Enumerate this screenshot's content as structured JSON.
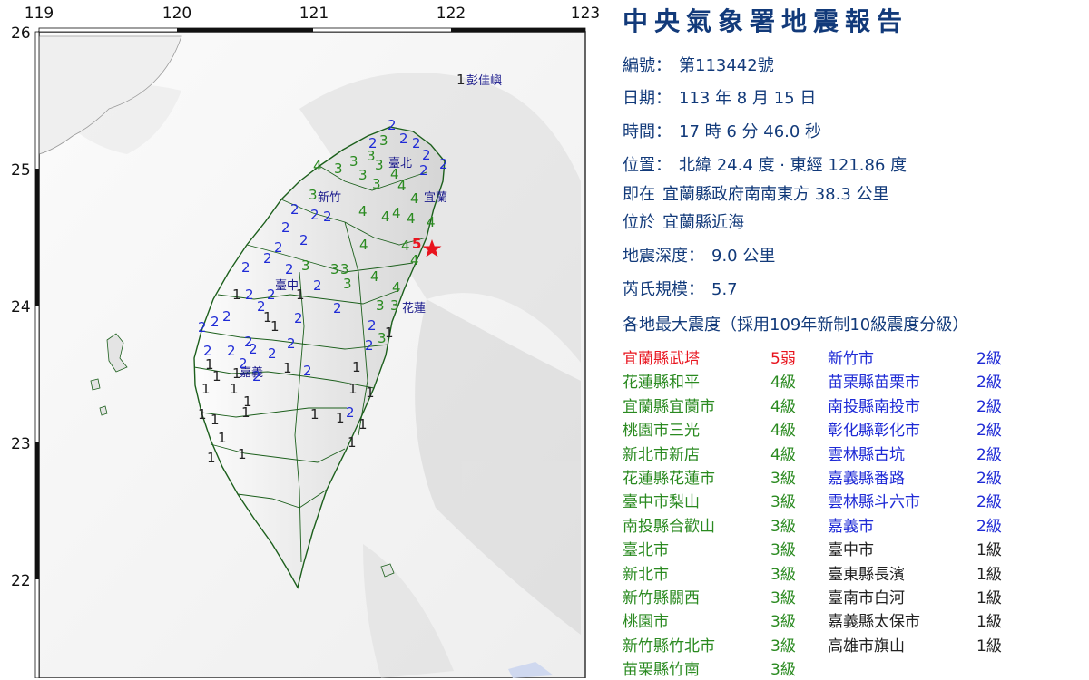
{
  "map": {
    "lon_ticks": [
      "119",
      "120",
      "121",
      "122",
      "123"
    ],
    "lat_ticks": [
      "26",
      "25",
      "24",
      "23",
      "22"
    ],
    "epicenter_label": "5",
    "epicenter_color": "#e8141e",
    "place_labels": {
      "pengjia": "彭佳嶼",
      "taipei": "臺北",
      "hsinchu": "新竹",
      "yilan": "宜蘭",
      "taichung": "臺中",
      "hualien": "花蓮",
      "chiayi": "嘉義"
    },
    "level_colors": {
      "1": "#222222",
      "2": "#1f2bd6",
      "3": "#2a8a20",
      "4": "#2a8a20",
      "5": "#e8141e"
    }
  },
  "report": {
    "title": "中央氣象署地震報告",
    "number_label": "編號：",
    "number_value": "第113442號",
    "date_label": "日期：",
    "date_value": "113 年 8 月 15 日",
    "time_label": "時間：",
    "time_value": "17 時 6 分 46.0 秒",
    "position_label": "位置：",
    "position_value": "北緯 24.4 度 · 東經 121.86 度",
    "relative_label": "即在",
    "relative_value": "宜蘭縣政府南南東方 38.3 公里",
    "area_label": "位於",
    "area_value": "宜蘭縣近海",
    "depth_label": "地震深度：",
    "depth_value": "9.0 公里",
    "magnitude_label": "芮氏規模：",
    "magnitude_value": "5.7",
    "intensity_heading": "各地最大震度（採用109年新制10級震度分級）",
    "stations_left": [
      {
        "name": "宜蘭縣武塔",
        "level": "5弱",
        "color": "#e8141e"
      },
      {
        "name": "花蓮縣和平",
        "level": "4級",
        "color": "#2a8a20"
      },
      {
        "name": "宜蘭縣宜蘭市",
        "level": "4級",
        "color": "#2a8a20"
      },
      {
        "name": "桃園市三光",
        "level": "4級",
        "color": "#2a8a20"
      },
      {
        "name": "新北市新店",
        "level": "4級",
        "color": "#2a8a20"
      },
      {
        "name": "花蓮縣花蓮市",
        "level": "3級",
        "color": "#2a8a20"
      },
      {
        "name": "臺中市梨山",
        "level": "3級",
        "color": "#2a8a20"
      },
      {
        "name": "南投縣合歡山",
        "level": "3級",
        "color": "#2a8a20"
      },
      {
        "name": "臺北市",
        "level": "3級",
        "color": "#2a8a20"
      },
      {
        "name": "新北市",
        "level": "3級",
        "color": "#2a8a20"
      },
      {
        "name": "新竹縣關西",
        "level": "3級",
        "color": "#2a8a20"
      },
      {
        "name": "桃園市",
        "level": "3級",
        "color": "#2a8a20"
      },
      {
        "name": "新竹縣竹北市",
        "level": "3級",
        "color": "#2a8a20"
      },
      {
        "name": "苗栗縣竹南",
        "level": "3級",
        "color": "#2a8a20"
      }
    ],
    "stations_right": [
      {
        "name": "新竹市",
        "level": "2級",
        "color": "#1f2bd6"
      },
      {
        "name": "苗栗縣苗栗市",
        "level": "2級",
        "color": "#1f2bd6"
      },
      {
        "name": "南投縣南投市",
        "level": "2級",
        "color": "#1f2bd6"
      },
      {
        "name": "彰化縣彰化市",
        "level": "2級",
        "color": "#1f2bd6"
      },
      {
        "name": "雲林縣古坑",
        "level": "2級",
        "color": "#1f2bd6"
      },
      {
        "name": "嘉義縣番路",
        "level": "2級",
        "color": "#1f2bd6"
      },
      {
        "name": "雲林縣斗六市",
        "level": "2級",
        "color": "#1f2bd6"
      },
      {
        "name": "嘉義市",
        "level": "2級",
        "color": "#1f2bd6"
      },
      {
        "name": "臺中市",
        "level": "1級",
        "color": "#222222"
      },
      {
        "name": "臺東縣長濱",
        "level": "1級",
        "color": "#222222"
      },
      {
        "name": "臺南市白河",
        "level": "1級",
        "color": "#222222"
      },
      {
        "name": "嘉義縣太保市",
        "level": "1級",
        "color": "#222222"
      },
      {
        "name": "高雄市旗山",
        "level": "1級",
        "color": "#222222"
      }
    ]
  }
}
